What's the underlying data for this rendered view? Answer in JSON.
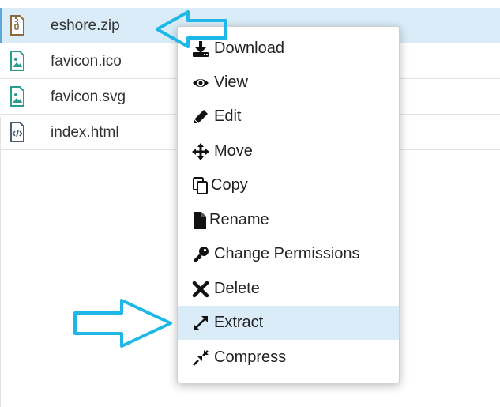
{
  "files": [
    {
      "name": "eshore.zip",
      "icon": "zip-file-icon",
      "selected": true
    },
    {
      "name": "favicon.ico",
      "icon": "image-file-icon",
      "selected": false
    },
    {
      "name": "favicon.svg",
      "icon": "image-file-icon",
      "selected": false
    },
    {
      "name": "index.html",
      "icon": "code-file-icon",
      "selected": false
    }
  ],
  "context_menu": {
    "items": [
      {
        "label": "Download",
        "icon": "download-icon"
      },
      {
        "label": "View",
        "icon": "eye-icon"
      },
      {
        "label": "Edit",
        "icon": "pencil-icon"
      },
      {
        "label": "Move",
        "icon": "move-arrows-icon"
      },
      {
        "label": "Copy",
        "icon": "copy-icon"
      },
      {
        "label": "Rename",
        "icon": "file-icon"
      },
      {
        "label": "Change Permissions",
        "icon": "key-icon"
      },
      {
        "label": "Delete",
        "icon": "x-icon"
      },
      {
        "label": "Extract",
        "icon": "expand-icon",
        "highlighted": true
      },
      {
        "label": "Compress",
        "icon": "compress-icon"
      }
    ]
  },
  "colors": {
    "selection_bg": "#d9ecf8",
    "annotation_arrow": "#1fb8e6",
    "zip_icon": "#8a6a3a",
    "image_icon": "#2a9d8f",
    "code_icon": "#4a5a78"
  }
}
